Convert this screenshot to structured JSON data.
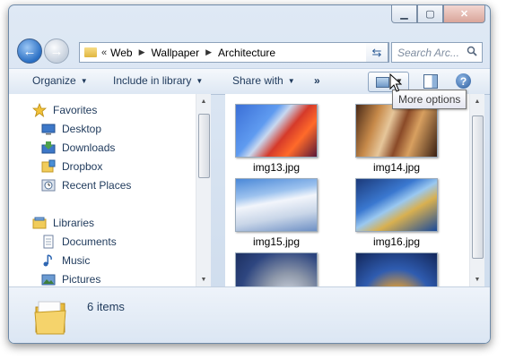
{
  "window": {
    "caption_buttons": {
      "minimize": "minimize-icon",
      "maximize": "maximize-icon",
      "close": "close-icon"
    }
  },
  "nav": {
    "breadcrumbs": [
      "Web",
      "Wallpaper",
      "Architecture"
    ],
    "overflow_chevron": "«",
    "search_placeholder": "Search Arc..."
  },
  "toolbar": {
    "organize_label": "Organize",
    "include_label": "Include in library",
    "share_label": "Share with",
    "overflow_label": "»",
    "tooltip": "More options"
  },
  "sidebar": {
    "favorites": {
      "label": "Favorites",
      "items": [
        "Desktop",
        "Downloads",
        "Dropbox",
        "Recent Places"
      ]
    },
    "libraries": {
      "label": "Libraries",
      "items": [
        "Documents",
        "Music",
        "Pictures"
      ]
    }
  },
  "files": [
    {
      "name": "img13.jpg"
    },
    {
      "name": "img14.jpg"
    },
    {
      "name": "img15.jpg"
    },
    {
      "name": "img16.jpg"
    },
    {
      "name": ""
    },
    {
      "name": ""
    }
  ],
  "details": {
    "item_count": "6 items"
  },
  "colors": {
    "accent": "#1e395b",
    "chrome": "#dfe9f5",
    "folder": "#f1cc5a"
  }
}
